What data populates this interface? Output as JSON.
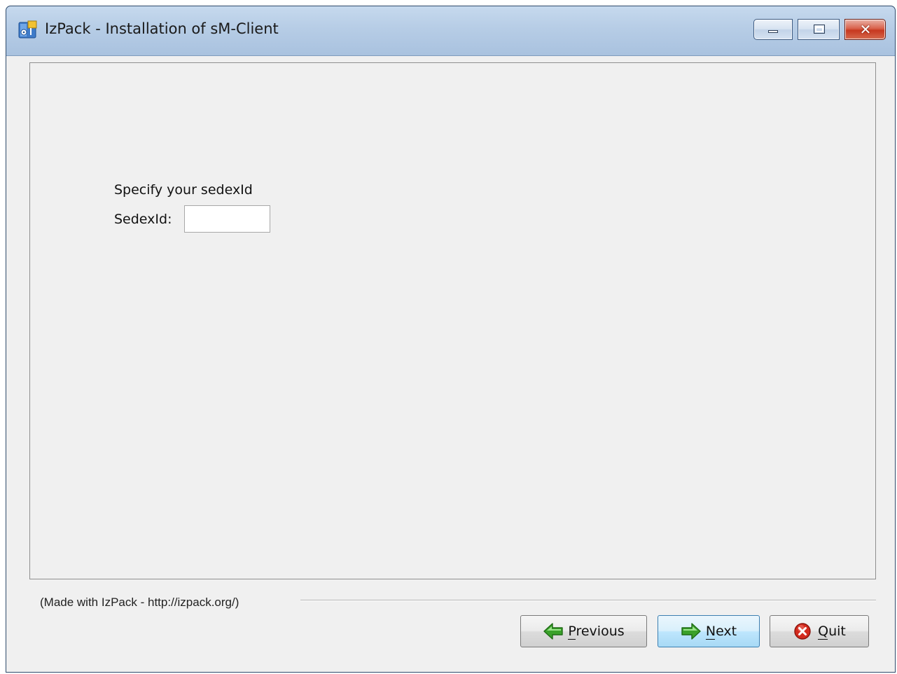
{
  "window": {
    "title": "IzPack - Installation of sM-Client"
  },
  "panel": {
    "prompt": "Specify your sedexId",
    "field_label": "SedexId:",
    "field_value": "",
    "field_placeholder": ""
  },
  "footer": {
    "credit": "(Made with IzPack - http://izpack.org/)",
    "buttons": {
      "previous": "Previous",
      "next": "Next",
      "quit": "Quit"
    }
  },
  "icons": {
    "app": "izpack-app-icon",
    "previous": "green-arrow-left-icon",
    "next": "green-arrow-right-icon",
    "quit": "red-circle-x-icon"
  },
  "colors": {
    "arrow_green": "#3aa12a",
    "quit_red": "#d32b1e",
    "next_button_border": "#3c7fb1"
  }
}
